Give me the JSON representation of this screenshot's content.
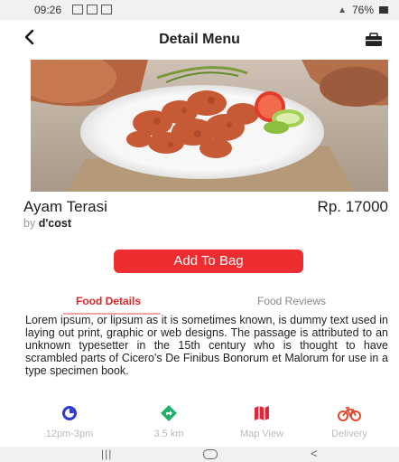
{
  "status_bar": {
    "time": "09:26",
    "battery": "76%"
  },
  "header": {
    "back_icon": "chevron-left-icon",
    "title": "Detail Menu",
    "bag_icon": "bag-icon"
  },
  "item": {
    "name": "Ayam Terasi",
    "price": "Rp. 17000",
    "by_prefix": "by",
    "vendor": "d'cost"
  },
  "actions": {
    "add_to_bag": "Add To Bag"
  },
  "tabs": [
    {
      "label": "Food Details",
      "active": true
    },
    {
      "label": "Food Reviews",
      "active": false
    }
  ],
  "description": "Lorem ipsum, or lipsum as it is sometimes known, is dummy text used in laying out print, graphic or web designs. The passage is attributed to an unknown typesetter in the 15th century who is thought to have scrambled parts of Cicero's De Finibus Bonorum et Malorum for use in a type specimen book.",
  "features": [
    {
      "label": "12pm-3pm",
      "icon": "clock-icon",
      "color": "#2d3bd6"
    },
    {
      "label": "3.5 km",
      "icon": "directions-icon",
      "color": "#1db46a"
    },
    {
      "label": "Map View",
      "icon": "map-icon",
      "color": "#e0263a"
    },
    {
      "label": "Delivery",
      "icon": "bicycle-icon",
      "color": "#e34a2b"
    }
  ],
  "accent_color": "#ee2d31"
}
